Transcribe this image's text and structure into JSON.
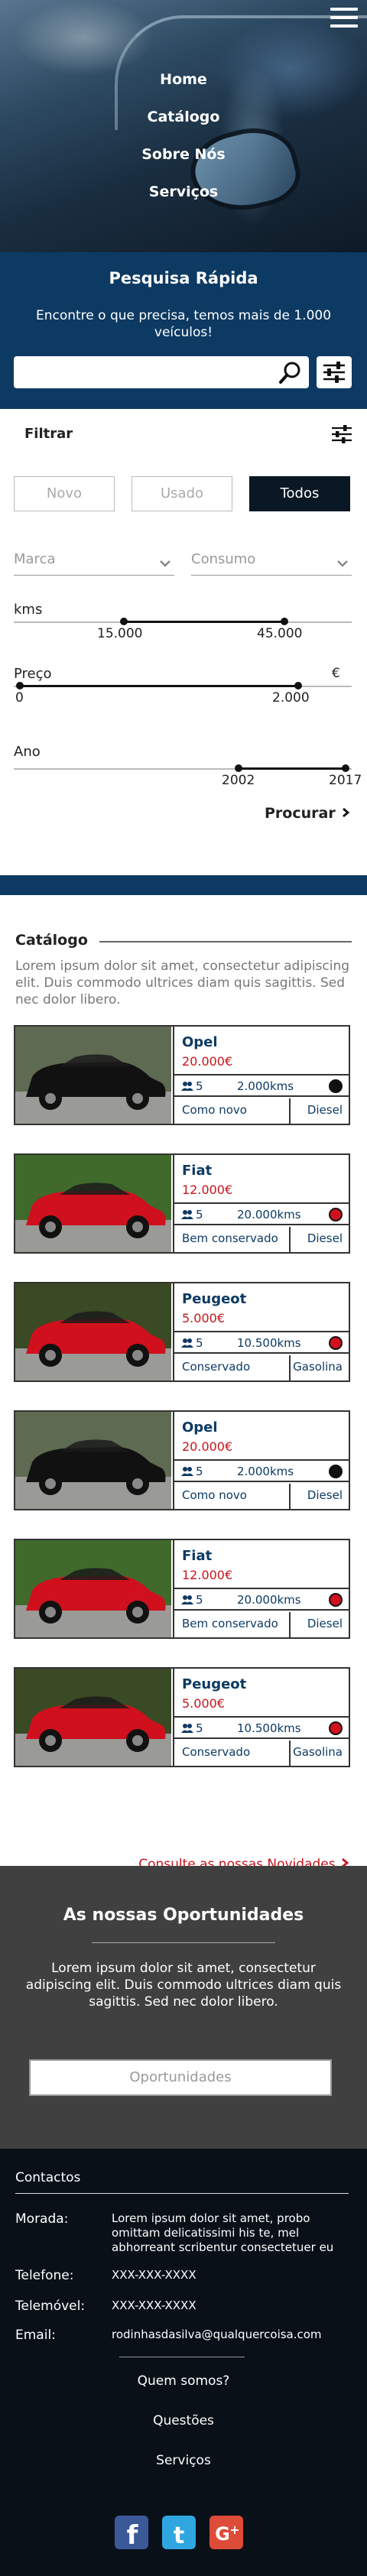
{
  "nav": {
    "items": [
      "Home",
      "Catálogo",
      "Sobre Nós",
      "Serviços"
    ]
  },
  "quick_search": {
    "title": "Pesquisa Rápida",
    "subtitle": "Encontre o que precisa, temos mais de 1.000 veículos!",
    "placeholder": ""
  },
  "filter": {
    "title": "Filtrar",
    "segments": [
      "Novo",
      "Usado",
      "Todos"
    ],
    "active_segment": "Todos",
    "dropdowns": [
      "Marca",
      "Consumo"
    ],
    "kms": {
      "label": "kms",
      "min": "15.000",
      "max": "45.000"
    },
    "price": {
      "label": "Preço",
      "unit": "€",
      "min": "0",
      "max": "2.000"
    },
    "year": {
      "label": "Ano",
      "min": "2002",
      "max": "2017"
    },
    "search_button": "Procurar"
  },
  "catalog": {
    "title": "Catálogo",
    "description": "Lorem ipsum dolor sit amet, consectetur adipiscing elit. Duis commodo ultrices diam quis sagittis. Sed nec dolor libero.",
    "cars": [
      {
        "name": "Opel",
        "price": "20.000€",
        "seats": "5",
        "km": "2.000kms",
        "condition": "Como novo",
        "fuel": "Diesel",
        "color": "#111111"
      },
      {
        "name": "Fiat",
        "price": "12.000€",
        "seats": "5",
        "km": "20.000kms",
        "condition": "Bem conservado",
        "fuel": "Diesel",
        "color": "#d0101c"
      },
      {
        "name": "Peugeot",
        "price": "5.000€",
        "seats": "5",
        "km": "10.500kms",
        "condition": "Conservado",
        "fuel": "Gasolina",
        "color": "#d0101c"
      },
      {
        "name": "Opel",
        "price": "20.000€",
        "seats": "5",
        "km": "2.000kms",
        "condition": "Como novo",
        "fuel": "Diesel",
        "color": "#111111"
      },
      {
        "name": "Fiat",
        "price": "12.000€",
        "seats": "5",
        "km": "20.000kms",
        "condition": "Bem conservado",
        "fuel": "Diesel",
        "color": "#d0101c"
      },
      {
        "name": "Peugeot",
        "price": "5.000€",
        "seats": "5",
        "km": "10.500kms",
        "condition": "Conservado",
        "fuel": "Gasolina",
        "color": "#d0101c"
      }
    ],
    "news_link": "Consulte as nossas Novidades"
  },
  "opportunities": {
    "title": "As nossas Oportunidades",
    "text": "Lorem ipsum dolor sit amet, consectetur adipiscing elit. Duis commodo ultrices diam quis sagittis. Sed nec dolor libero.",
    "button": "Oportunidades"
  },
  "footer": {
    "title": "Contactos",
    "morada_label": "Morada:",
    "morada": "Lorem ipsum dolor sit amet, probo omittam delicatissimi his te, mel abhorreant scribentur consectetuer eu",
    "telefone_label": "Telefone:",
    "telefone": "XXX-XXX-XXXX",
    "telemovel_label": "Telemóvel:",
    "telemovel": "XXX-XXX-XXXX",
    "email_label": "Email:",
    "email": "rodinhasdasilva@qualquercoisa.com",
    "links": [
      "Quem somos?",
      "Questões",
      "Serviços"
    ],
    "social": [
      "facebook",
      "twitter",
      "google-plus"
    ]
  },
  "colors": {
    "navy": "#0d3a63",
    "dark": "#0a1825",
    "red": "#c8151d",
    "gray_section": "#404040",
    "footer_bg": "#0a1018"
  }
}
